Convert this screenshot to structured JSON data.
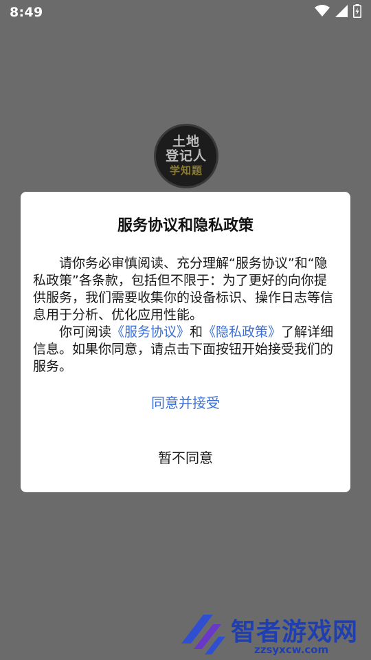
{
  "status_bar": {
    "time": "8:49",
    "icons": [
      "wifi-icon",
      "signal-icon",
      "battery-charging-icon"
    ]
  },
  "app_logo": {
    "lines": [
      "土地",
      "登记人",
      "学知题"
    ]
  },
  "dialog": {
    "title": "服务协议和隐私政策",
    "paragraph1": "请你务必审慎阅读、充分理解“服务协议”和“隐私政策”各条款，包括但不限于：为了更好的向你提供服务，我们需要收集你的设备标识、操作日志等信息用于分析、优化应用性能。",
    "paragraph2_prefix": "你可阅读",
    "terms_link": "《服务协议》",
    "paragraph2_and": "和",
    "privacy_link": "《隐私政策》",
    "paragraph2_suffix": "了解详细信息。如果你同意，请点击下面按钮开始接受我们的服务。",
    "accept_label": "同意并接受",
    "decline_label": "暂不同意"
  },
  "watermark": {
    "name": "智者游戏网",
    "url": "zzsyxcw.com"
  },
  "colors": {
    "overlay": "#6b6b6b",
    "link": "#3b6fd6",
    "watermark": "#1f3fb0"
  }
}
